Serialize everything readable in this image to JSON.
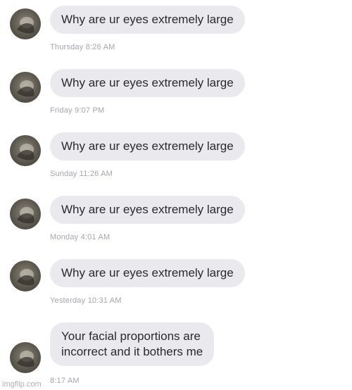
{
  "messages": [
    {
      "text": "Why are ur eyes extremely large",
      "time": "Thursday 8:26 AM"
    },
    {
      "text": "Why are ur eyes extremely large",
      "time": "Friday 9:07 PM"
    },
    {
      "text": "Why are ur eyes extremely large",
      "time": "Sunday 11:26 AM"
    },
    {
      "text": "Why are ur eyes extremely large",
      "time": "Monday 4:01 AM"
    },
    {
      "text": "Why are ur eyes extremely large",
      "time": "Yesterday 10:31 AM"
    },
    {
      "text_line1": "Your facial proportions are",
      "text_line2": "incorrect and it bothers me",
      "time": "8:17 AM"
    }
  ],
  "watermark": "imgflip.com",
  "icons": {
    "avatar": "profile-avatar"
  },
  "colors": {
    "bubble": "#eaeaee",
    "timestamp": "#a5a5ad",
    "text": "#2a2a2c"
  }
}
